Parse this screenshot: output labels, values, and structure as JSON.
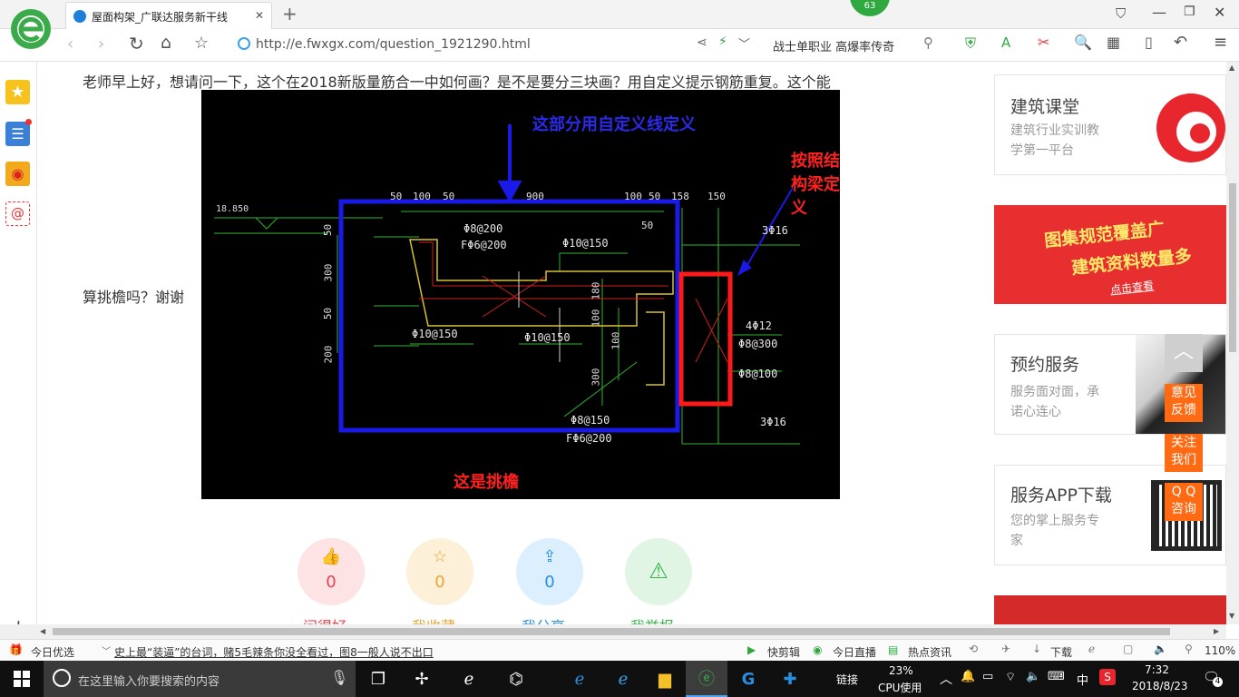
{
  "tab": {
    "title": "屋面构架_广联达服务新干线",
    "close": "✕",
    "new_tab": "+"
  },
  "top_badge": "63",
  "address": {
    "url": "http://e.fwxgx.com/question_1921290.html",
    "search_hint": "战士单职业 高爆率传奇"
  },
  "question": {
    "line1": "老师早上好，想请问一下，这个在2018新版量筋合一中如何画？是不是要分三块画？用自定义提示钢筋重复。这个能",
    "line2": "算挑檐吗？谢谢"
  },
  "cad": {
    "annot_top": "这部分用自定义线定义",
    "annot_right": "按照结构梁定义",
    "annot_bottom": "这是挑檐",
    "elev": "18.850",
    "dims_top": [
      "50",
      "100",
      "50",
      "900",
      "100",
      "50",
      "158",
      "150"
    ],
    "dim_50b": "50",
    "left_dims": [
      "50",
      "300",
      "50",
      "200"
    ],
    "mid_dims": [
      "180",
      "100",
      "100",
      "300"
    ],
    "rebar": [
      "Φ8@200",
      "FΦ6@200",
      "Φ10@150",
      "Φ10@150",
      "Φ10@150",
      "Φ8@150",
      "FΦ6@200"
    ],
    "beam": [
      "3Φ16",
      "4Φ12",
      "Φ8@300",
      "Φ8@100",
      "3Φ16"
    ]
  },
  "actions": [
    {
      "icon": "thumbs-up-icon",
      "glyph": "👍",
      "count": "0",
      "label": "问得好",
      "color": "#e8434f",
      "bg": "#fde3e4"
    },
    {
      "icon": "star-icon",
      "glyph": "☆",
      "count": "0",
      "label": "我收藏",
      "color": "#e9a437",
      "bg": "#fdf0d8"
    },
    {
      "icon": "share-icon",
      "glyph": "⇪",
      "count": "0",
      "label": "我分享",
      "color": "#2a8ee0",
      "bg": "#dcefff"
    },
    {
      "icon": "warning-icon",
      "glyph": "⚠",
      "count": "",
      "label": "我举报",
      "color": "#39b54a",
      "bg": "#e0f5e3"
    }
  ],
  "cards": [
    {
      "title": "建筑课堂",
      "sub1": "建筑行业实训教",
      "sub2": "学第一平台"
    },
    {
      "ad1": "图集规范覆盖广",
      "ad2": "建筑资料数量多",
      "ad3": "点击查看"
    },
    {
      "title": "预约服务",
      "sub1": "服务面对面，承",
      "sub2": "诺心连心"
    },
    {
      "title": "服务APP下载",
      "sub1": "您的掌上服务专",
      "sub2": "家"
    }
  ],
  "float_buttons": {
    "feedback1": "意见",
    "feedback2": "反馈",
    "follow1": "关注",
    "follow2": "我们",
    "qq1": "Q Q",
    "qq2": "咨询"
  },
  "status": {
    "today": "今日优选",
    "news": "史上最“装逼”的台词，赌5毛辣条你没全看过，图8一般人说不出口",
    "clip": "快剪辑",
    "live": "今日直播",
    "hot": "热点资讯",
    "download": "下载",
    "zoom": "110%"
  },
  "taskbar": {
    "search": "在这里输入你要搜索的内容",
    "link": "链接",
    "cpu_pct": "23%",
    "cpu": "CPU使用",
    "ime": "中",
    "time": "7:32",
    "date": "2018/8/23",
    "notif": "4"
  }
}
